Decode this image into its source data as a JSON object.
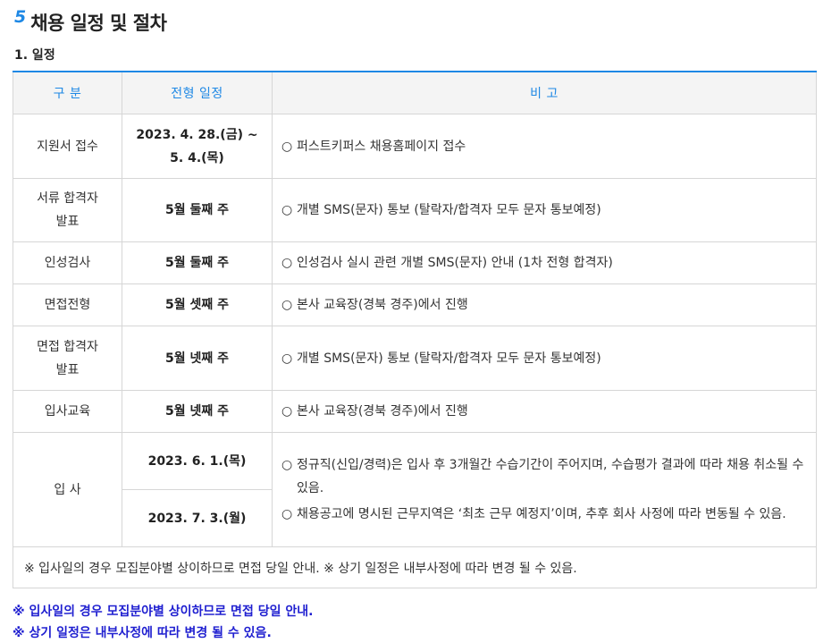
{
  "section": {
    "number": "5",
    "title": "채용 일정 및 절차"
  },
  "subsection": {
    "title": "1. 일정"
  },
  "table": {
    "headers": [
      "구 분",
      "전형 일정",
      "비 고"
    ],
    "bullet": "○",
    "rows": [
      {
        "category_lines": [
          "지원서 접수"
        ],
        "dates": [
          "2023. 4. 28.(금) ~ 5. 4.(목)"
        ],
        "notes": [
          "퍼스트키퍼스 채용홈페이지 접수"
        ]
      },
      {
        "category_lines": [
          "서류 합격자",
          "발표"
        ],
        "dates": [
          "5월 둘째 주"
        ],
        "notes": [
          "개별 SMS(문자) 통보 (탈락자/합격자 모두 문자 통보예정)"
        ]
      },
      {
        "category_lines": [
          "인성검사"
        ],
        "dates": [
          "5월 둘째 주"
        ],
        "notes": [
          "인성검사 실시 관련 개별 SMS(문자) 안내 (1차 전형 합격자)"
        ]
      },
      {
        "category_lines": [
          "면접전형"
        ],
        "dates": [
          "5월 셋째 주"
        ],
        "notes": [
          "본사 교육장(경북 경주)에서 진행"
        ]
      },
      {
        "category_lines": [
          "면접 합격자",
          "발표"
        ],
        "dates": [
          "5월 넷째 주"
        ],
        "notes": [
          "개별 SMS(문자) 통보 (탈락자/합격자 모두 문자 통보예정)"
        ]
      },
      {
        "category_lines": [
          "입사교육"
        ],
        "dates": [
          "5월 넷째 주"
        ],
        "notes": [
          "본사 교육장(경북 경주)에서 진행"
        ]
      },
      {
        "category_lines": [
          "입 사"
        ],
        "dates": [
          "2023. 6. 1.(목)",
          "2023. 7. 3.(월)"
        ],
        "notes": [
          "정규직(신입/경력)은 입사 후 3개월간 수습기간이 주어지며, 수습평가 결과에 따라 채용 취소될 수 있음.",
          "채용공고에 명시된 근무지역은 ‘최초 근무 예정지’이며, 추후 회사 사정에 따라 변동될 수 있음."
        ]
      }
    ],
    "memo": "※ 입사일의 경우 모집분야별 상이하므로 면접 당일 안내. ※ 상기 일정은 내부사정에 따라 변경 될 수 있음."
  },
  "footnotes": [
    "※ 입사일의 경우 모집분야별 상이하므로 면접 당일 안내.",
    "※ 상기 일정은 내부사정에 따라 변경 될 수 있음."
  ],
  "colors": {
    "accent": "#1e88e5",
    "footnote": "#1f1fd0",
    "header_bg": "#f4f4f4",
    "border": "#d6d6d6"
  }
}
